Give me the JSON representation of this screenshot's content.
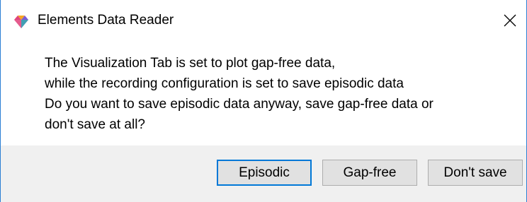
{
  "window": {
    "title": "Elements Data Reader",
    "icon": "elements-diamond-icon",
    "close_icon": "close-icon"
  },
  "message": {
    "lines": [
      "The Visualization Tab is set to plot gap-free data,",
      "while the recording configuration is set to save episodic data",
      "Do you want to save episodic data anyway, save gap-free data or",
      "don't save at all?"
    ]
  },
  "buttons": {
    "episodic": "Episodic",
    "gap_free": "Gap-free",
    "dont_save": "Don't save"
  },
  "colors": {
    "accent": "#0078d7",
    "window_border": "#2b7fd4",
    "footer_bg": "#f0f0f0",
    "button_bg": "#e1e1e1",
    "icon_colors": [
      "#e0457b",
      "#f5a623",
      "#7b5cd6",
      "#2fb5a8"
    ]
  }
}
